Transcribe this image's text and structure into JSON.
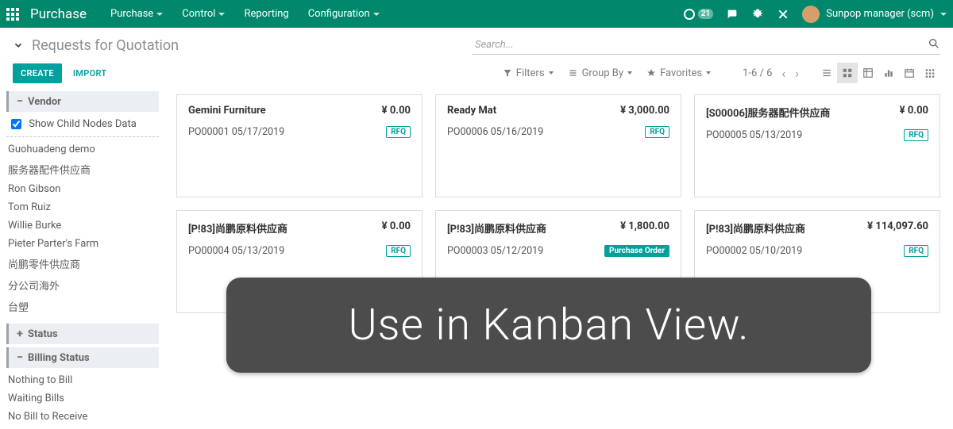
{
  "top": {
    "app_name": "Purchase",
    "menus": [
      {
        "label": "Purchase",
        "has_caret": true
      },
      {
        "label": "Control",
        "has_caret": true
      },
      {
        "label": "Reporting",
        "has_caret": false
      },
      {
        "label": "Configuration",
        "has_caret": true
      }
    ],
    "badge_count": "21",
    "user_name": "Sunpop manager (scm)"
  },
  "cp": {
    "breadcrumb": "Requests for Quotation",
    "search_placeholder": "Search...",
    "create": "CREATE",
    "import": "IMPORT",
    "filters": "Filters",
    "groupby": "Group By",
    "favorites": "Favorites",
    "pager": "1-6 / 6"
  },
  "sidebar": {
    "vendor_title": "Vendor",
    "show_child": "Show Child Nodes Data",
    "show_child_checked": true,
    "vendors": [
      "Guohuadeng demo",
      "服务器配件供应商",
      "Ron Gibson",
      "Tom Ruiz",
      "Willie Burke",
      "Pieter Parter's Farm",
      "尚鹏零件供应商",
      "分公司海外",
      "台塑"
    ],
    "status_title": "Status",
    "billing_title": "Billing Status",
    "billing": [
      "Nothing to Bill",
      "Waiting Bills",
      "No Bill to Receive"
    ]
  },
  "cards": [
    {
      "title": "Gemini Furniture",
      "amount": "¥ 0.00",
      "ref": "PO00001 05/17/2019",
      "badge": "RFQ",
      "filled": false
    },
    {
      "title": "Ready Mat",
      "amount": "¥ 3,000.00",
      "ref": "PO00006 05/16/2019",
      "badge": "RFQ",
      "filled": false
    },
    {
      "title": "[S00006]服务器配件供应商",
      "amount": "¥ 0.00",
      "ref": "PO00005 05/13/2019",
      "badge": "RFQ",
      "filled": false
    },
    {
      "title": "[P!83]尚鹏原料供应商",
      "amount": "¥ 0.00",
      "ref": "PO00004 05/13/2019",
      "badge": "RFQ",
      "filled": false
    },
    {
      "title": "[P!83]尚鹏原料供应商",
      "amount": "¥ 1,800.00",
      "ref": "PO00003 05/12/2019",
      "badge": "Purchase Order",
      "filled": true
    },
    {
      "title": "[P!83]尚鹏原料供应商",
      "amount": "¥ 114,097.60",
      "ref": "PO00002 05/10/2019",
      "badge": "RFQ",
      "filled": false
    }
  ],
  "overlay_text": "Use in Kanban View."
}
